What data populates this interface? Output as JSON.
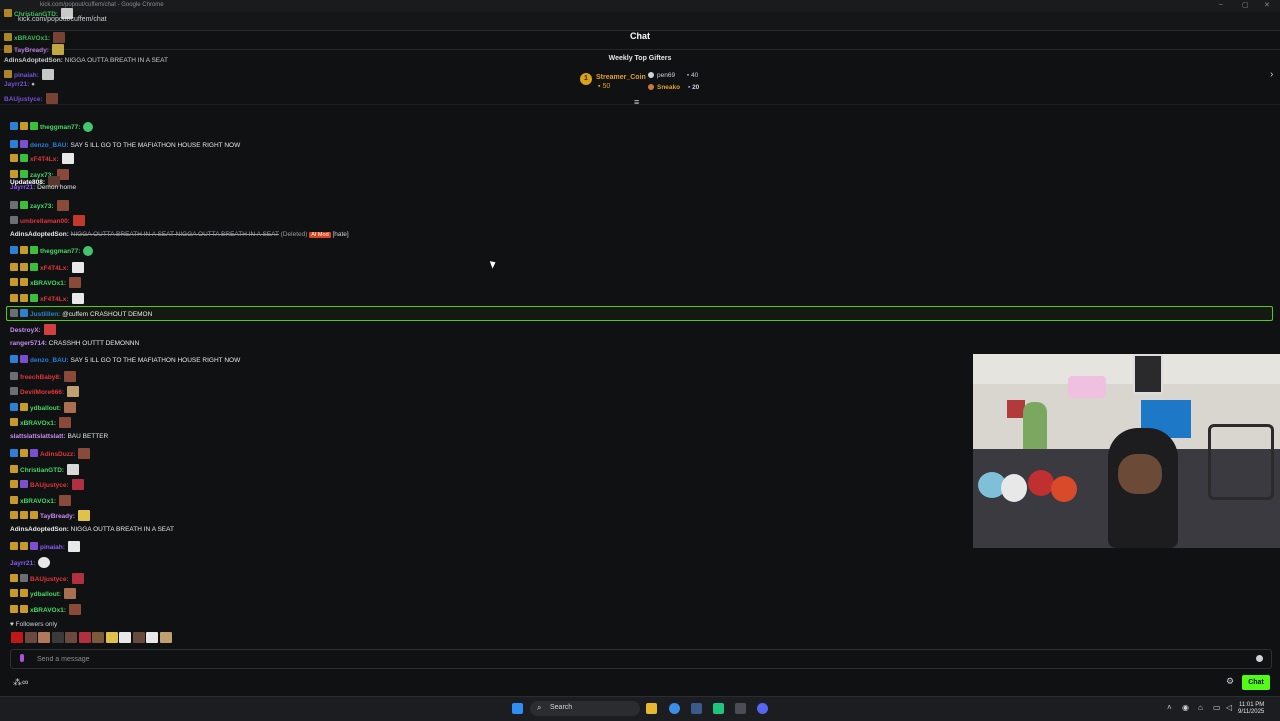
{
  "browser": {
    "title": "kick.com/popout/cuffem/chat - Google Chrome",
    "url": "kick.com/popout/cuffem/chat"
  },
  "header": {
    "title": "Chat"
  },
  "gifters": {
    "title": "Weekly Top Gifters",
    "top": {
      "name": "Streamer_Coin",
      "count": "50"
    },
    "second": {
      "name": "pen69",
      "count": "40"
    },
    "third": {
      "name": "Sneako",
      "count": "20"
    }
  },
  "overlay_messages": [
    {
      "user": "ChristianGTD:",
      "color": "#49d866"
    },
    {
      "user": "xBRAVOx1:",
      "color": "#49d866"
    },
    {
      "user": "TayBready:",
      "color": "#c98cf0"
    },
    {
      "user": "AdinsAdoptedSon:",
      "text": "NIGGA OUTTA BREATH IN A SEAT",
      "color": "#ffffff"
    },
    {
      "user": "pinaiah:",
      "color": "#8b5cf6"
    },
    {
      "user": "Jayrr21:",
      "color": "#8b5cf6"
    },
    {
      "user": "BAUjustyce:",
      "color": "#8b5cf6"
    }
  ],
  "messages": [
    {
      "user": "theggman77:",
      "text": "",
      "color": "#49d866"
    },
    {
      "user": "denzo_BAU:",
      "text": "SAY 5 ILL GO TO THE MAFIATHON HOUSE RIGHT NOW",
      "color": "#2d7fd4"
    },
    {
      "user": "xF4T4Lx:",
      "text": "",
      "color": "#e2363a"
    },
    {
      "user": "zayx73:",
      "text": "",
      "color": "#49d866"
    },
    {
      "user": "Update808:",
      "text": "",
      "color": "#ffffff"
    },
    {
      "user": "Jayrr21:",
      "text": "Demon home",
      "color": "#8b5cf6"
    },
    {
      "user": "zayx73:",
      "text": "",
      "color": "#49d866"
    },
    {
      "user": "umbrellaman00:",
      "text": "",
      "color": "#e2363a"
    },
    {
      "user": "AdinsAdoptedSon:",
      "text": "NIGGA OUTTA BREATH IN A SEAT NIGGA OUTTA BREATH IN A SEAT",
      "deleted_label": "(Deleted)",
      "mod_tag": "AI Mod",
      "reason": "[hate]",
      "color": "#ffffff"
    },
    {
      "user": "theggman77:",
      "text": "",
      "color": "#49d866"
    },
    {
      "user": "xF4T4Lx:",
      "text": "",
      "color": "#e2363a"
    },
    {
      "user": "xBRAVOx1:",
      "text": "",
      "color": "#49d866"
    },
    {
      "user": "xF4T4Lx:",
      "text": "",
      "color": "#e2363a"
    },
    {
      "user": "Justlillen:",
      "text": "@cuffem CRASHOUT DEMON",
      "color": "#2d7fd4"
    },
    {
      "user": "DestroyX:",
      "text": "",
      "color": "#c98cf0"
    },
    {
      "user": "ranger5714:",
      "text": "CRASSHH OUTTT DEMONNN",
      "color": "#c98cf0"
    },
    {
      "user": "denzo_BAU:",
      "text": "SAY 5 ILL GO TO THE MAFIATHON HOUSE RIGHT NOW",
      "color": "#2d7fd4"
    },
    {
      "user": "freechBaby8:",
      "text": "",
      "color": "#e2363a"
    },
    {
      "user": "DevilMore666:",
      "text": "",
      "color": "#e2363a"
    },
    {
      "user": "ydballout:",
      "text": "",
      "color": "#49d866"
    },
    {
      "user": "xBRAVOx1:",
      "text": "",
      "color": "#49d866"
    },
    {
      "user": "slattslattslattslatt:",
      "text": "BAU BETTER",
      "color": "#c98cf0"
    },
    {
      "user": "AdinsDuzz:",
      "text": "",
      "color": "#e2363a"
    },
    {
      "user": "ChristianGTD:",
      "text": "",
      "color": "#49d866"
    },
    {
      "user": "BAUjustyce:",
      "text": "",
      "color": "#e2363a"
    },
    {
      "user": "xBRAVOx1:",
      "text": "",
      "color": "#49d866"
    },
    {
      "user": "TayBready:",
      "text": "",
      "color": "#c98cf0"
    },
    {
      "user": "AdinsAdoptedSon:",
      "text": "NIGGA OUTTA BREATH IN A SEAT",
      "color": "#ffffff"
    },
    {
      "user": "pinaiah:",
      "text": "",
      "color": "#8b5cf6"
    },
    {
      "user": "Jayrr21:",
      "text": "",
      "color": "#8b5cf6"
    },
    {
      "user": "BAUjustyce:",
      "text": "",
      "color": "#e2363a"
    },
    {
      "user": "ydballout:",
      "text": "",
      "color": "#49d866"
    },
    {
      "user": "xBRAVOx1:",
      "text": "",
      "color": "#49d866"
    }
  ],
  "footer": {
    "followers_label": "Followers only",
    "input_placeholder": "Send a message",
    "chat_button": "Chat"
  },
  "taskbar": {
    "search_label": "Search",
    "time": "11:01 PM",
    "date": "9/11/2025"
  },
  "colors": {
    "accent": "#53fc18",
    "highlight_border": "#53c91c"
  }
}
